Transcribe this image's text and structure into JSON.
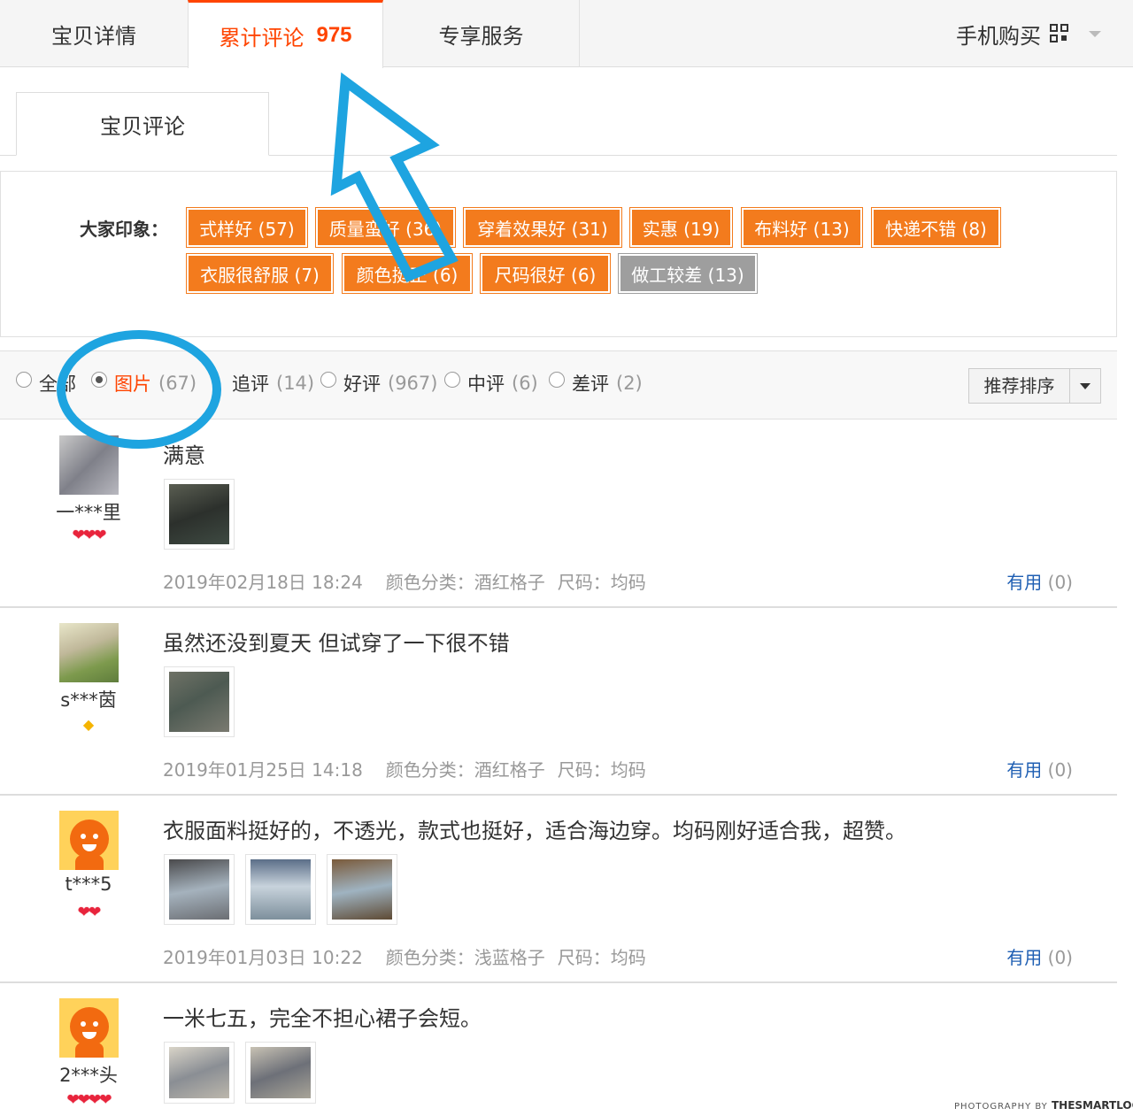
{
  "top_tabs": {
    "details": "宝贝详情",
    "reviews_label": "累计评论",
    "reviews_count": "975",
    "service": "专享服务",
    "mobile": "手机购买"
  },
  "sub_tab": "宝贝评论",
  "impressions": {
    "label": "大家印象：",
    "tags": [
      "式样好 (57)",
      "质量蛮好 (36)",
      "穿着效果好 (31)",
      "实惠 (19)",
      "布料好 (13)",
      "快递不错 (8)",
      "衣服很舒服 (7)",
      "颜色挺正 (6)",
      "尺码很好 (6)",
      "做工较差 (13)"
    ]
  },
  "filters": {
    "all": "全部",
    "pictures": "图片",
    "pictures_count": "(67)",
    "followup": "追评",
    "followup_count": "(14)",
    "good": "好评",
    "good_count": "(967)",
    "neutral": "中评",
    "neutral_count": "(6)",
    "bad": "差评",
    "bad_count": "(2)",
    "sort_label": "推荐排序"
  },
  "reviews": [
    {
      "user": "一***里",
      "level": "❤❤❤",
      "text": "满意",
      "date": "2019年02月18日 18:24",
      "color": "颜色分类：酒红格子",
      "size": "尺码：均码",
      "useful_label": "有用",
      "useful_count": "(0)"
    },
    {
      "user": "s***茵",
      "level": "◆",
      "text": "虽然还没到夏天 但试穿了一下很不错",
      "date": "2019年01月25日 14:18",
      "color": "颜色分类：酒红格子",
      "size": "尺码：均码",
      "useful_label": "有用",
      "useful_count": "(0)"
    },
    {
      "user": "t***5",
      "level": "❤❤",
      "text": "衣服面料挺好的，不透光，款式也挺好，适合海边穿。均码刚好适合我，超赞。",
      "date": "2019年01月03日 10:22",
      "color": "颜色分类：浅蓝格子",
      "size": "尺码：均码",
      "useful_label": "有用",
      "useful_count": "(0)"
    },
    {
      "user": "2***头",
      "level": "❤❤❤❤",
      "text": "一米七五，完全不担心裙子会短。"
    }
  ],
  "watermark": {
    "prefix": "PHOTOGRAPHY BY",
    "brand": "THESMARTLOCAL"
  },
  "colors": {
    "accent": "#ff4400",
    "tag_orange": "#f37b1d",
    "tag_gray": "#9e9e9e",
    "annotation_blue": "#1ea4e0",
    "link_blue": "#1f5fb3"
  }
}
